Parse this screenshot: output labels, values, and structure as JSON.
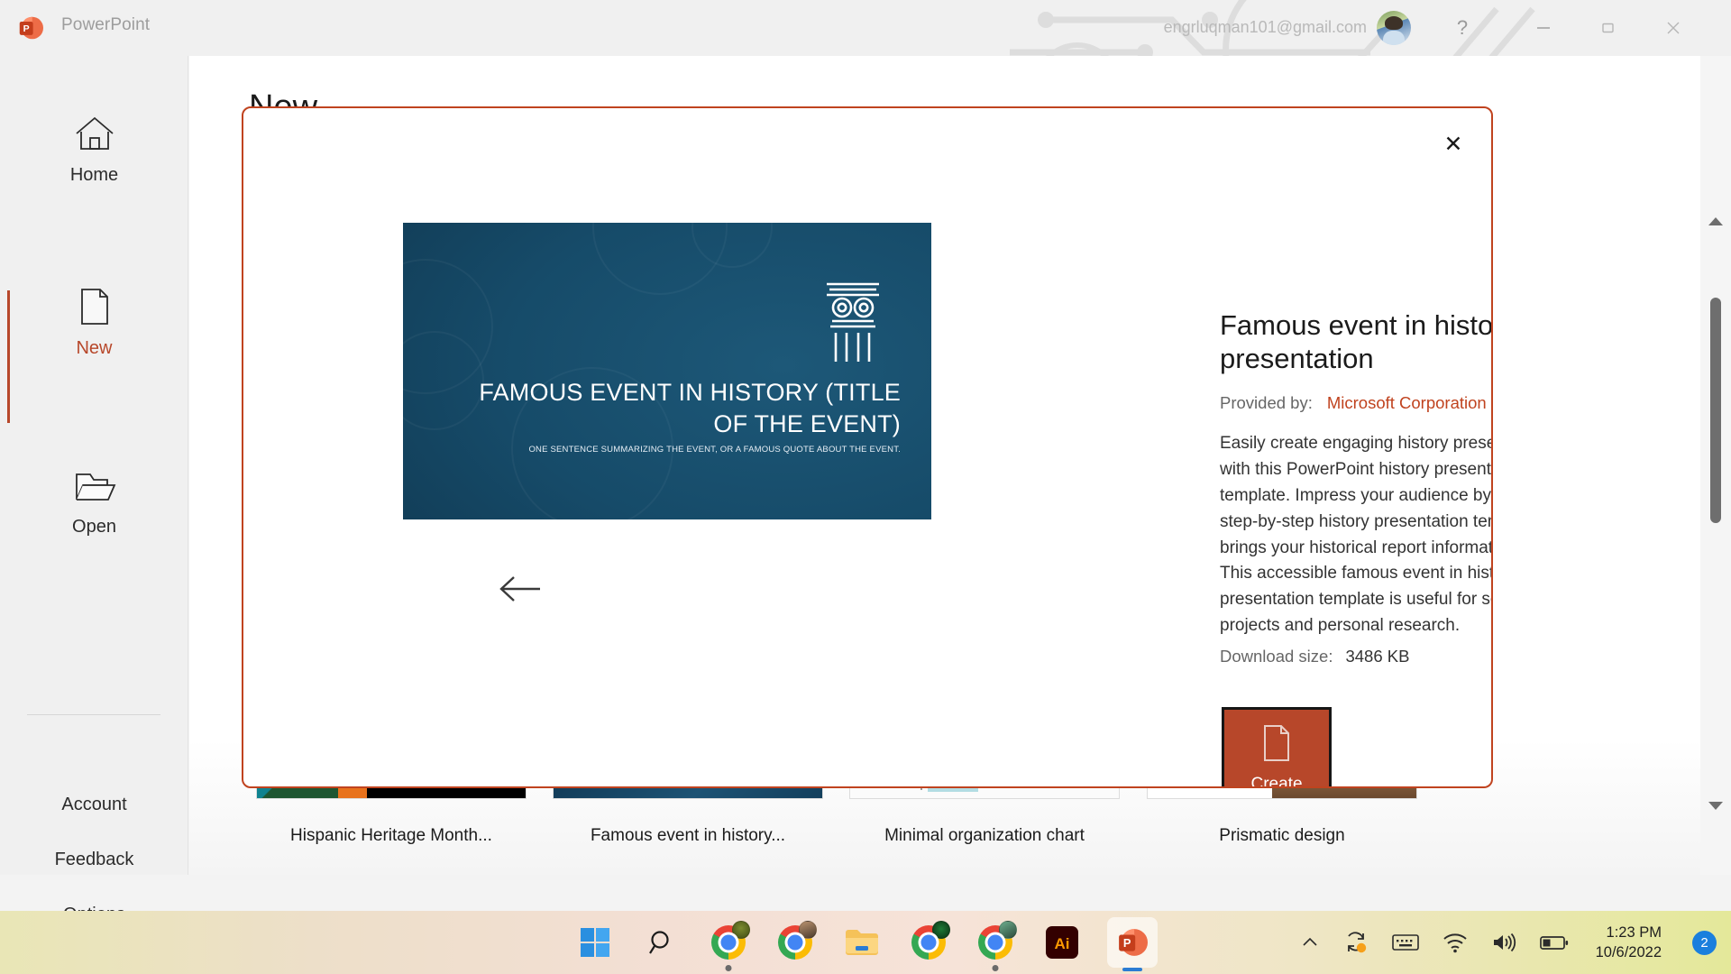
{
  "titlebar": {
    "app_name": "PowerPoint",
    "account_email": "engrluqman101@gmail.com",
    "help_label": "?",
    "minimize_label": "minimize",
    "maximize_label": "maximize",
    "close_label": "close"
  },
  "sidebar": {
    "items": [
      {
        "label": "Home",
        "icon": "home-icon"
      },
      {
        "label": "New",
        "icon": "new-document-icon",
        "selected": true
      },
      {
        "label": "Open",
        "icon": "open-folder-icon"
      }
    ],
    "links": [
      {
        "label": "Account"
      },
      {
        "label": "Feedback"
      },
      {
        "label": "Options"
      }
    ],
    "accent_color": "#b7472a"
  },
  "page": {
    "heading": "New"
  },
  "templates": [
    {
      "label": "Hispanic Heritage Month...",
      "thumb": "hispanic"
    },
    {
      "label": "Famous event in history...",
      "thumb": "famous",
      "thumb_subtitle": "ONE SENTENCE SUMMARIZING THE EVENT, OR A FAMOUS QUOTE ABOUT THE EVENT."
    },
    {
      "label": "Minimal organization chart",
      "thumb": "org"
    },
    {
      "label": "Prismatic design",
      "thumb": "prismatic"
    }
  ],
  "dialog": {
    "close_label": "✕",
    "prev_label": "←",
    "next_label": "→",
    "preview": {
      "title": "FAMOUS EVENT IN HISTORY (TITLE OF THE EVENT)",
      "subtitle": "ONE SENTENCE SUMMARIZING THE EVENT, OR A FAMOUS QUOTE ABOUT THE EVENT.",
      "icon": "ionic-column-icon"
    },
    "title": "Famous event in history presentation",
    "provided_by_label": "Provided by:",
    "provided_by_value": "Microsoft Corporation",
    "description": "Easily create engaging history presentations with this PowerPoint history presentation template. Impress your audience by using this step-by-step history presentation template that brings your historical report information to life. This accessible famous event in history presentation template is useful for school projects and personal research.",
    "download_size_label": "Download size:",
    "download_size_value": "3486 KB",
    "create_label": "Create",
    "border_color": "#c0431f",
    "link_color": "#c0431f"
  },
  "taskbar": {
    "apps": [
      {
        "name": "start-button"
      },
      {
        "name": "search-button"
      },
      {
        "name": "chrome-window-1",
        "running": true
      },
      {
        "name": "chrome-window-2"
      },
      {
        "name": "file-explorer"
      },
      {
        "name": "chrome-window-3"
      },
      {
        "name": "chrome-window-4",
        "running": true
      },
      {
        "name": "illustrator"
      },
      {
        "name": "powerpoint",
        "active": true
      }
    ],
    "tray": {
      "overflow_label": "∧",
      "sync_label": "sync",
      "keyboard_label": "keyboard",
      "wifi_label": "wifi",
      "volume_label": "volume",
      "battery_label": "battery"
    },
    "clock": {
      "time": "1:23 PM",
      "date": "10/6/2022"
    },
    "notification_count": "2"
  }
}
